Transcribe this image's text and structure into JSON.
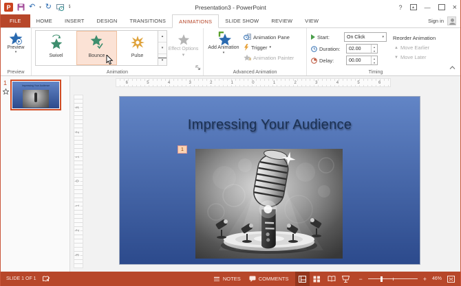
{
  "titlebar": {
    "title": "Presentation3 - PowerPoint",
    "help": "?"
  },
  "tabs": {
    "items": [
      {
        "label": "FILE"
      },
      {
        "label": "HOME"
      },
      {
        "label": "INSERT"
      },
      {
        "label": "DESIGN"
      },
      {
        "label": "TRANSITIONS"
      },
      {
        "label": "ANIMATIONS"
      },
      {
        "label": "SLIDE SHOW"
      },
      {
        "label": "REVIEW"
      },
      {
        "label": "VIEW"
      }
    ],
    "active": "ANIMATIONS",
    "sign_in": "Sign in"
  },
  "ribbon": {
    "preview": {
      "button": "Preview",
      "group_label": "Preview"
    },
    "animation": {
      "items": [
        {
          "name": "Swivel"
        },
        {
          "name": "Bounce"
        },
        {
          "name": "Pulse"
        }
      ],
      "hovered_item": "Bounce",
      "effect_options": "Effect Options",
      "group_label": "Animation"
    },
    "advanced": {
      "add_animation": "Add Animation",
      "animation_pane": "Animation Pane",
      "trigger": "Trigger",
      "animation_painter": "Animation Painter",
      "group_label": "Advanced Animation"
    },
    "timing": {
      "start_label": "Start:",
      "start_value": "On Click",
      "duration_label": "Duration:",
      "duration_value": "02.00",
      "delay_label": "Delay:",
      "delay_value": "00.00",
      "reorder_label": "Reorder Animation",
      "move_earlier": "Move Earlier",
      "move_later": "Move Later",
      "group_label": "Timing"
    }
  },
  "thumbnail_panel": {
    "slide_number": "1"
  },
  "rulers": {
    "horizontal": [
      "6",
      "5",
      "4",
      "3",
      "2",
      "1",
      "0",
      "1",
      "2",
      "3",
      "4",
      "5",
      "6"
    ],
    "vertical": [
      "3",
      "2",
      "1",
      "0",
      "1",
      "2",
      "3"
    ]
  },
  "slide": {
    "title": "Impressing Your Audience",
    "animation_tag": "1"
  },
  "statusbar": {
    "slide_indicator": "SLIDE 1 OF 1",
    "notes": "NOTES",
    "comments": "COMMENTS",
    "zoom_value": "46%"
  },
  "colors": {
    "accent": "#B7472A",
    "gallery_hover_bg": "#FBE2D5",
    "star_green": "#3E8E6E",
    "star_gold": "#DFA33C",
    "star_blue": "#2A6AB0",
    "slide_gradient_top": "#6285C6",
    "slide_gradient_bottom": "#2C4A8C"
  },
  "icons": {
    "caret_down": "▾",
    "spin_up": "▴",
    "spin_down": "▾",
    "triangle_up": "▲",
    "triangle_down": "▼",
    "undo": "↶",
    "redo": "↻",
    "minimize": "—",
    "close": "×",
    "check": "✓",
    "minus": "−",
    "plus": "+",
    "gallery_up": "▲",
    "gallery_down": "▼"
  }
}
